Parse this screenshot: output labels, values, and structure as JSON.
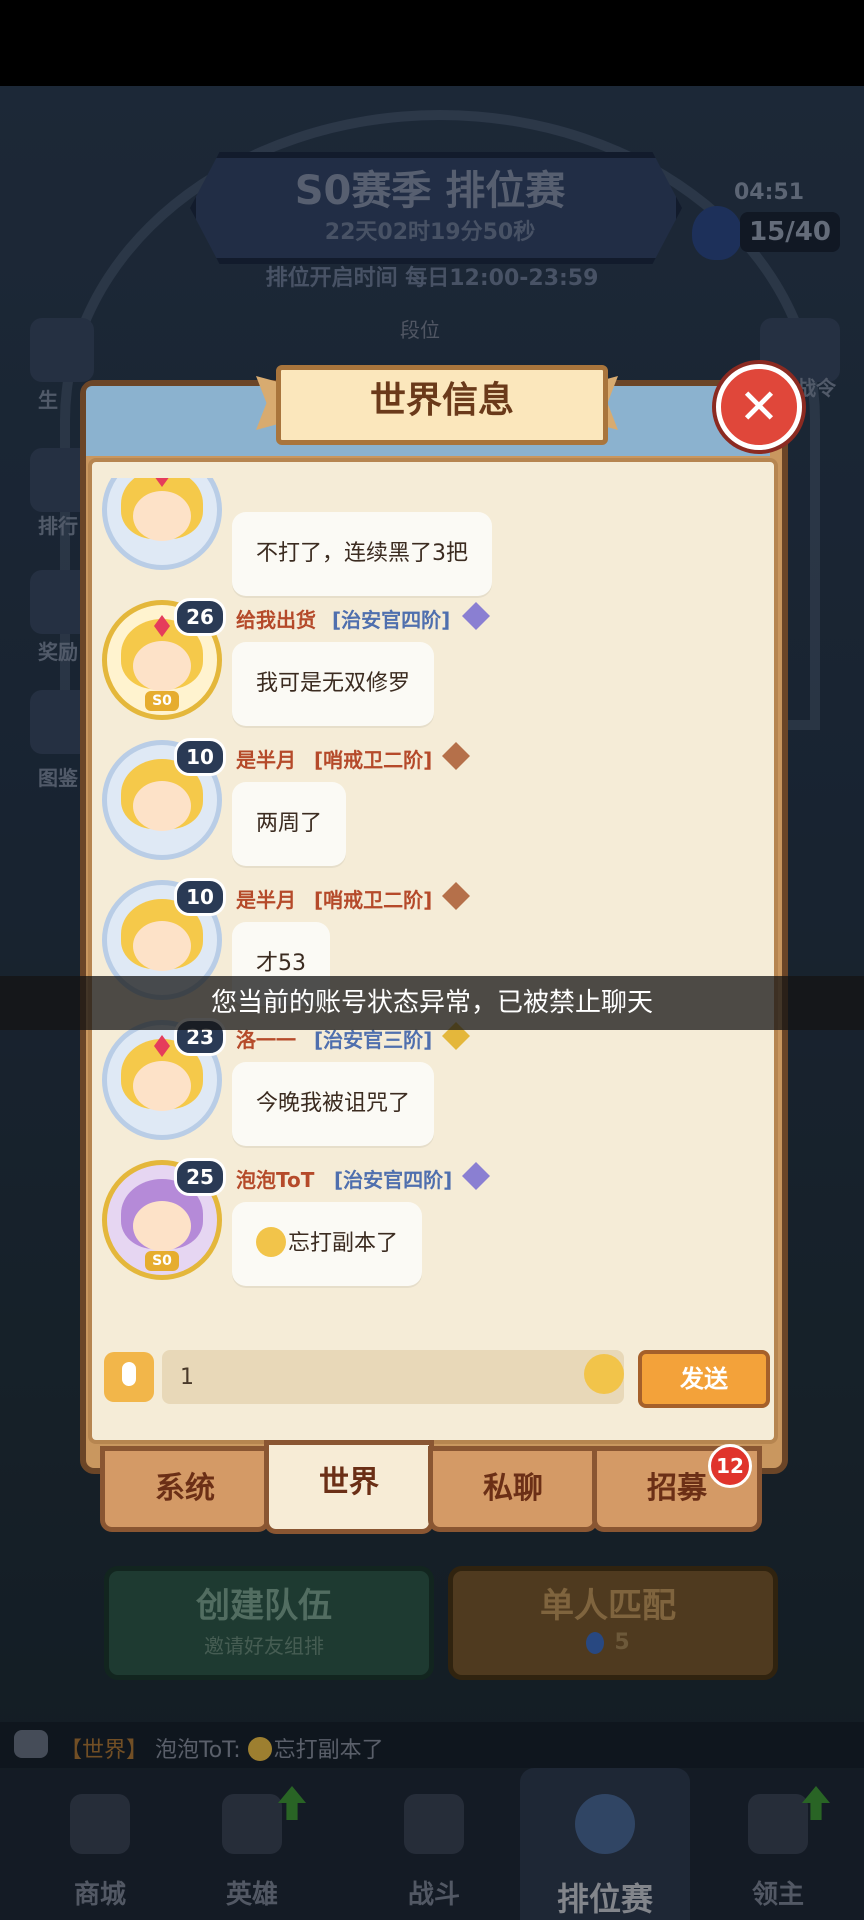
{
  "season": {
    "title": "S0赛季 排位赛",
    "countdown": "22天02时19分50秒",
    "open_time": "排位开启时间 每日12:00-23:59",
    "clock": "04:51",
    "energy": "15/40",
    "rank_label": "段位"
  },
  "side_menu": [
    "生",
    "排行",
    "奖励",
    "图鉴"
  ],
  "battle_pass_label": "战令",
  "dialog": {
    "title": "世界信息",
    "messages": [
      {
        "level": "",
        "name": "",
        "rank": "",
        "text": "不打了，连续黑了3把",
        "has_so": false,
        "rank_color": "blue"
      },
      {
        "level": "26",
        "name": "给我出货",
        "rank": "[治安官四阶]",
        "text": "我可是无双修罗",
        "has_so": true,
        "rank_color": "blue"
      },
      {
        "level": "10",
        "name": "是半月",
        "rank": "[哨戒卫二阶]",
        "text": "两周了",
        "has_so": false,
        "rank_color": "brown"
      },
      {
        "level": "10",
        "name": "是半月",
        "rank": "[哨戒卫二阶]",
        "text": "才53",
        "has_so": false,
        "rank_color": "brown"
      },
      {
        "level": "23",
        "name": "洛一一",
        "rank": "[治安官三阶]",
        "text": "今晚我被诅咒了",
        "has_so": false,
        "rank_color": "blue"
      },
      {
        "level": "25",
        "name": "泡泡ToT",
        "rank": "[治安官四阶]",
        "text": "忘打副本了",
        "has_so": true,
        "rank_color": "blue"
      }
    ],
    "input_value": "1",
    "send_label": "发送",
    "tabs": [
      "系统",
      "世界",
      "私聊",
      "招募"
    ],
    "recruit_badge": "12"
  },
  "toast": "您当前的账号状态异常，已被禁止聊天",
  "actions": {
    "create_team": "创建队伍",
    "create_team_sub": "邀请好友组排",
    "solo_match": "单人匹配",
    "solo_cost": "5"
  },
  "ticker": {
    "channel": "【世界】",
    "sender": "泡泡ToT:",
    "text": "忘打副本了"
  },
  "nav": [
    "商城",
    "英雄",
    "战斗",
    "排位赛",
    "领主"
  ],
  "colors": {
    "accent_orange": "#f3a23a",
    "close_red": "#e0473a",
    "name_red": "#b54a2a",
    "rank_blue": "#4f6fae"
  }
}
